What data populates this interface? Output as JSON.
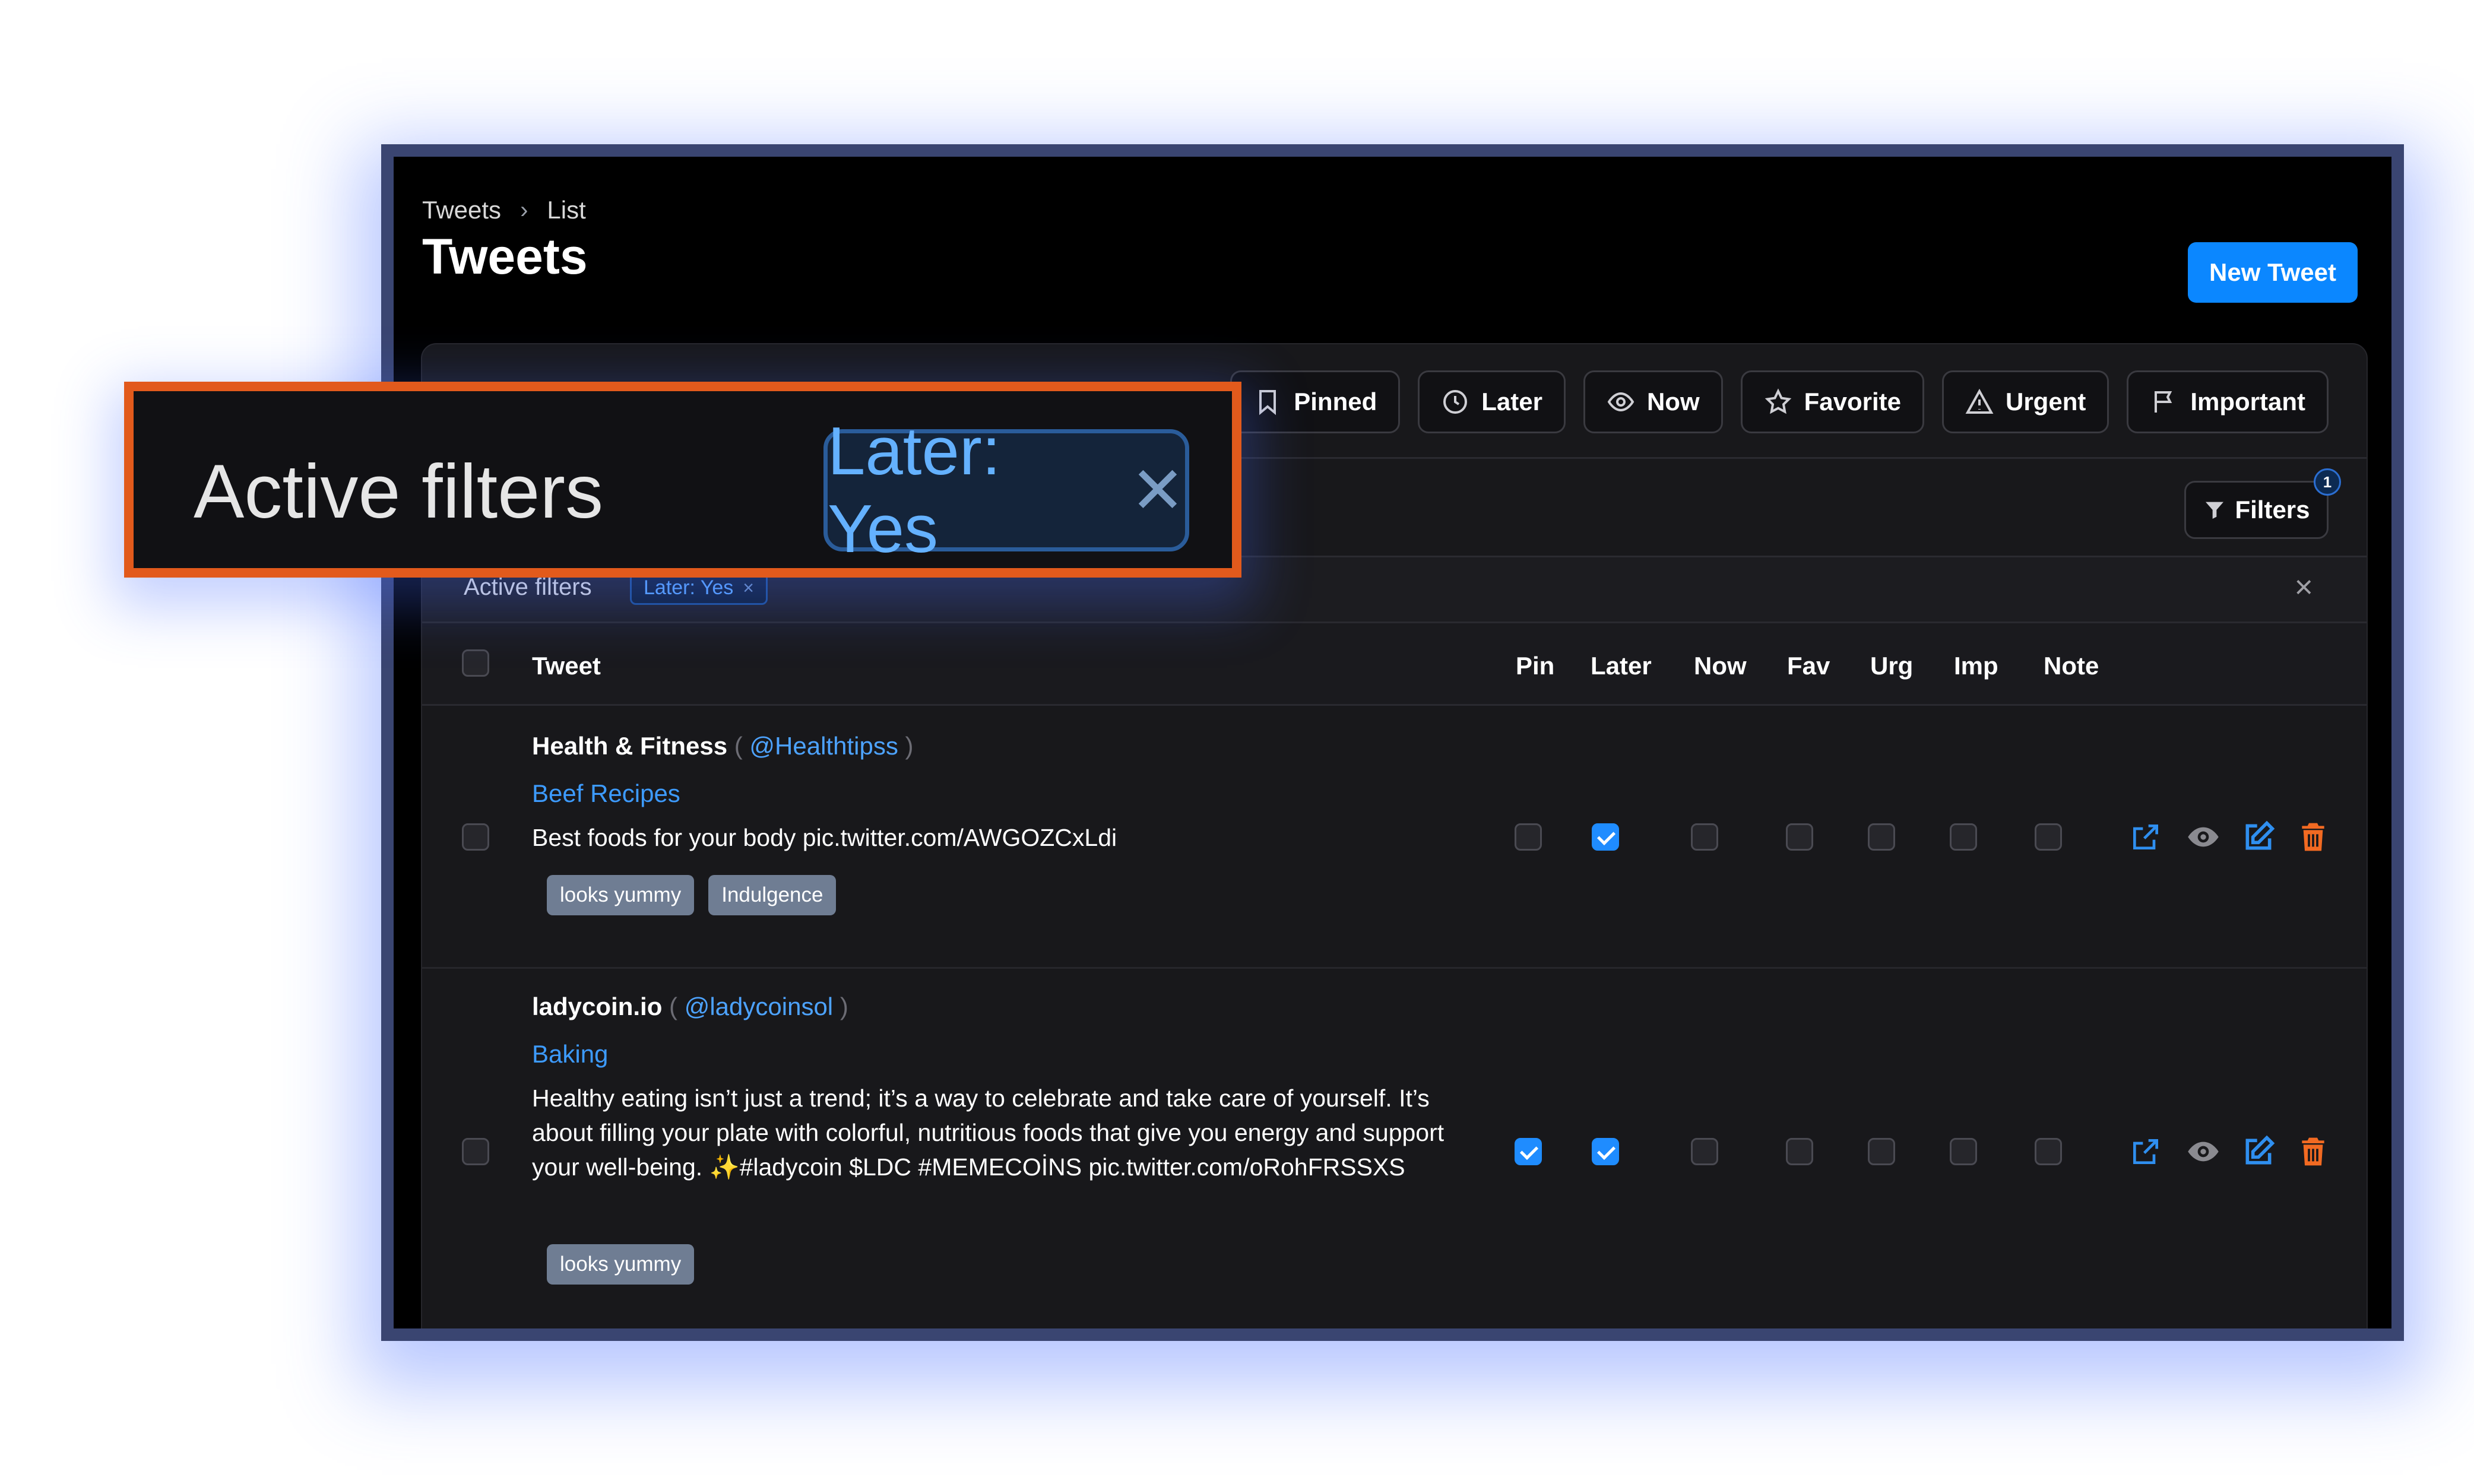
{
  "breadcrumb": {
    "root": "Tweets",
    "current": "List"
  },
  "page_title": "Tweets",
  "new_button_label": "New Tweet",
  "tabs": [
    {
      "label": "Pinned",
      "icon": "bookmark-icon"
    },
    {
      "label": "Later",
      "icon": "clock-icon"
    },
    {
      "label": "Now",
      "icon": "eye-icon"
    },
    {
      "label": "Favorite",
      "icon": "star-icon"
    },
    {
      "label": "Urgent",
      "icon": "warning-icon"
    },
    {
      "label": "Important",
      "icon": "flag-icon"
    }
  ],
  "filters": {
    "label": "Filters",
    "count": "1"
  },
  "active_filters": {
    "label": "Active filters",
    "chip": "Later: Yes"
  },
  "columns": {
    "tweet": "Tweet",
    "pin": "Pin",
    "later": "Later",
    "now": "Now",
    "fav": "Fav",
    "urg": "Urg",
    "imp": "Imp",
    "note": "Note"
  },
  "rows": [
    {
      "author": "Health & Fitness",
      "handle": "@Healthtipss",
      "category": "Beef Recipes",
      "text": "Best foods for your body pic.twitter.com/AWGOZCxLdi",
      "tags": [
        "looks yummy",
        "Indulgence"
      ],
      "flags": {
        "pin": false,
        "later": true,
        "now": false,
        "fav": false,
        "urg": false,
        "imp": false,
        "note": false
      }
    },
    {
      "author": "ladycoin.io",
      "handle": "@ladycoinsol",
      "category": "Baking",
      "text": "Healthy eating isn’t just a trend; it’s a way to celebrate and take care of yourself. It’s about filling your plate with colorful, nutritious foods that give you energy and support your well-being. ✨#ladycoin $LDC #MEMECOİNS pic.twitter.com/oRohFRSSXS",
      "tags": [
        "looks yummy"
      ],
      "flags": {
        "pin": true,
        "later": true,
        "now": false,
        "fav": false,
        "urg": false,
        "imp": false,
        "note": false
      }
    }
  ],
  "colors": {
    "accent": "#0b87ff",
    "highlight_border": "#e25a1c",
    "delete": "#f26a22",
    "chip_text": "#5aa7ff"
  }
}
